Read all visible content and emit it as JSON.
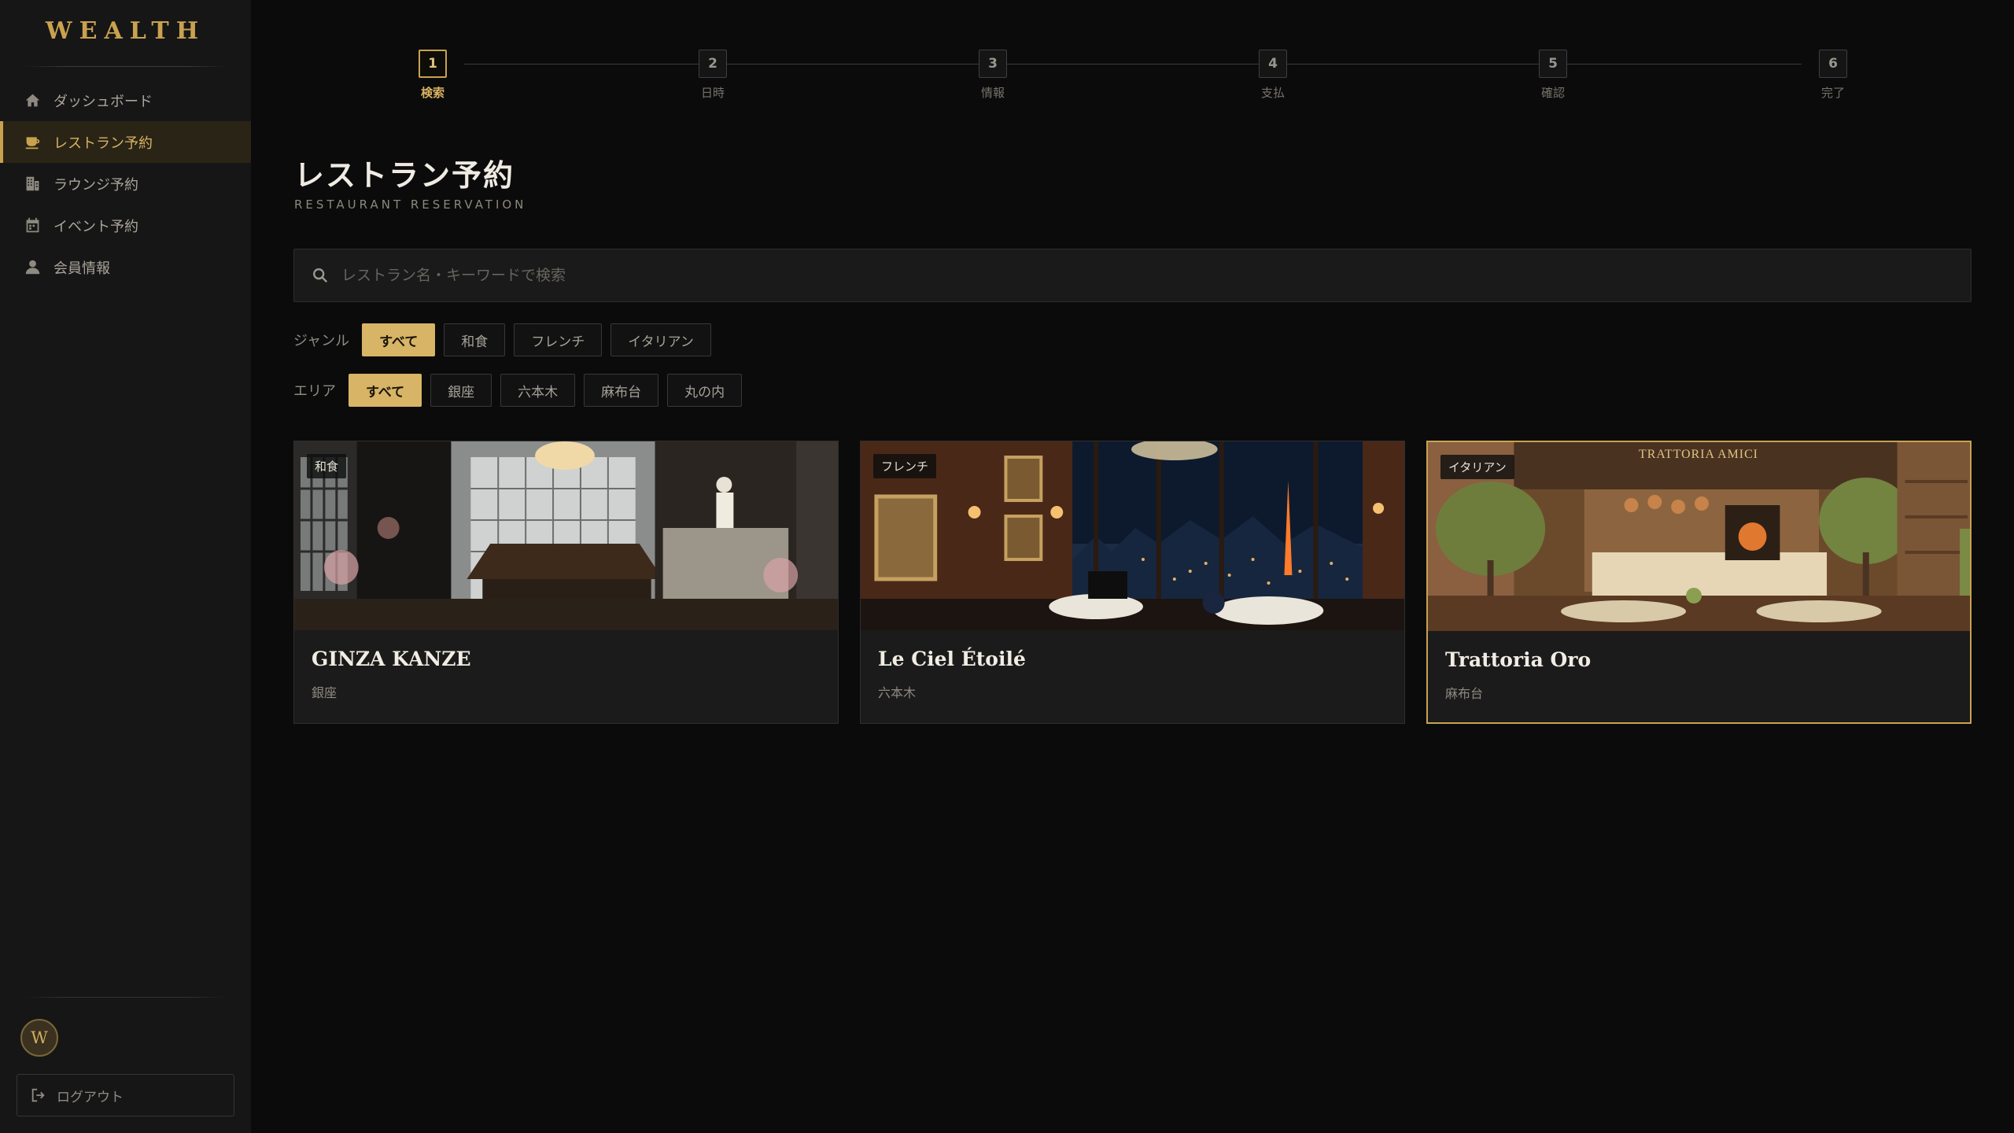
{
  "brand": "WEALTH",
  "sidebar": {
    "items": [
      {
        "label": "ダッシュボード",
        "icon": "home-icon"
      },
      {
        "label": "レストラン予約",
        "icon": "coffee-icon",
        "active": true
      },
      {
        "label": "ラウンジ予約",
        "icon": "building-icon"
      },
      {
        "label": "イベント予約",
        "icon": "calendar-icon"
      },
      {
        "label": "会員情報",
        "icon": "user-icon"
      }
    ],
    "avatar_initial": "W",
    "logout_label": "ログアウト"
  },
  "stepper": {
    "current": 1,
    "steps": [
      {
        "num": "1",
        "label": "検索"
      },
      {
        "num": "2",
        "label": "日時"
      },
      {
        "num": "3",
        "label": "情報"
      },
      {
        "num": "4",
        "label": "支払"
      },
      {
        "num": "5",
        "label": "確認"
      },
      {
        "num": "6",
        "label": "完了"
      }
    ]
  },
  "page": {
    "title": "レストラン予約",
    "subtitle": "RESTAURANT RESERVATION"
  },
  "search": {
    "placeholder": "レストラン名・キーワードで検索",
    "value": ""
  },
  "filters": {
    "genre": {
      "label": "ジャンル",
      "options": [
        "すべて",
        "和食",
        "フレンチ",
        "イタリアン"
      ],
      "selected": "すべて"
    },
    "area": {
      "label": "エリア",
      "options": [
        "すべて",
        "銀座",
        "六本木",
        "麻布台",
        "丸の内"
      ],
      "selected": "すべて"
    }
  },
  "restaurants": [
    {
      "name": "GINZA KANZE",
      "genre": "和食",
      "area": "銀座"
    },
    {
      "name": "Le Ciel Étoilé",
      "genre": "フレンチ",
      "area": "六本木"
    },
    {
      "name": "Trattoria Oro",
      "genre": "イタリアン",
      "area": "麻布台",
      "sign_text": "TRATTORIA AMICI"
    }
  ],
  "colors": {
    "accent": "#c9a24f",
    "background": "#0b0b0b",
    "sidebar": "#161616"
  }
}
